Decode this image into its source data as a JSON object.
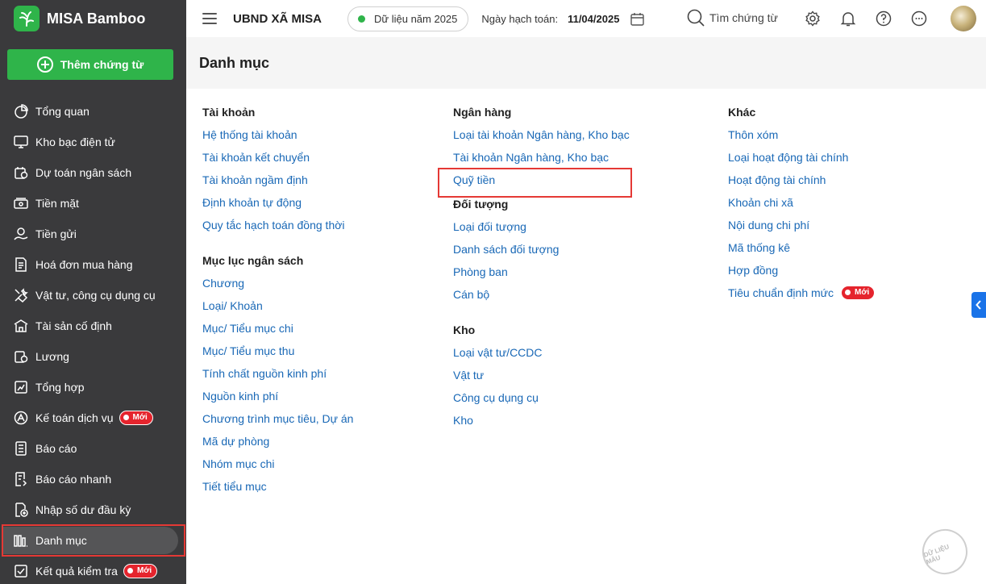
{
  "brand": {
    "name": "MISA Bamboo"
  },
  "sidebar": {
    "add_button": "Thêm chứng từ",
    "items": [
      {
        "label": "Tổng quan",
        "icon": "pie-chart-icon"
      },
      {
        "label": "Kho bạc điện tử",
        "icon": "monitor-icon"
      },
      {
        "label": "Dự toán ngân sách",
        "icon": "budget-icon"
      },
      {
        "label": "Tiền mặt",
        "icon": "cash-icon"
      },
      {
        "label": "Tiền gửi",
        "icon": "deposit-icon"
      },
      {
        "label": "Hoá đơn mua hàng",
        "icon": "invoice-icon"
      },
      {
        "label": "Vật tư, công cụ dụng cụ",
        "icon": "tools-icon"
      },
      {
        "label": "Tài sản cố định",
        "icon": "building-icon"
      },
      {
        "label": "Lương",
        "icon": "salary-icon"
      },
      {
        "label": "Tổng hợp",
        "icon": "summary-icon"
      },
      {
        "label": "Kế toán dịch vụ",
        "icon": "service-icon",
        "badge": "Mới"
      },
      {
        "label": "Báo cáo",
        "icon": "report-icon"
      },
      {
        "label": "Báo cáo nhanh",
        "icon": "quick-report-icon"
      },
      {
        "label": "Nhập số dư đầu kỳ",
        "icon": "opening-balance-icon"
      },
      {
        "label": "Danh mục",
        "icon": "catalog-icon",
        "active": true
      },
      {
        "label": "Kết quả kiểm tra",
        "icon": "check-result-icon",
        "badge": "Mới"
      }
    ]
  },
  "topbar": {
    "org_name": "UBND XÃ MISA",
    "data_year": "Dữ liệu năm 2025",
    "posting_date_label": "Ngày hạch toán:",
    "posting_date": "11/04/2025",
    "search_placeholder": "Tìm chứng từ"
  },
  "page": {
    "title": "Danh mục",
    "columns": [
      {
        "sections": [
          {
            "title": "Tài khoản",
            "links": [
              "Hệ thống tài khoản",
              "Tài khoản kết chuyển",
              "Tài khoản ngầm định",
              "Định khoản tự động",
              "Quy tắc hạch toán đồng thời"
            ]
          },
          {
            "title": "Mục lục ngân sách",
            "links": [
              "Chương",
              "Loại/ Khoản",
              "Mục/ Tiểu mục chi",
              "Mục/ Tiểu mục thu",
              "Tính chất nguồn kinh phí",
              "Nguồn kinh phí",
              "Chương trình mục tiêu, Dự án",
              "Mã dự phòng",
              "Nhóm mục chi",
              "Tiết tiểu mục"
            ]
          }
        ]
      },
      {
        "sections": [
          {
            "title": "Ngân hàng",
            "links": [
              "Loại tài khoản Ngân hàng, Kho bạc",
              "Tài khoản Ngân hàng, Kho bạc",
              "Quỹ tiền"
            ]
          },
          {
            "title": "Đối tượng",
            "links": [
              "Loại đối tượng",
              "Danh sách đối tượng",
              "Phòng ban",
              "Cán bộ"
            ]
          },
          {
            "title": "Kho",
            "links": [
              "Loại vật tư/CCDC",
              "Vật tư",
              "Công cụ dụng cụ",
              "Kho"
            ]
          }
        ]
      },
      {
        "sections": [
          {
            "title": "Khác",
            "links": [
              "Thôn xóm",
              "Loại hoạt động tài chính",
              "Hoạt động tài chính",
              "Khoản chi xã",
              "Nội dung chi phí",
              "Mã thống kê",
              "Hợp đồng",
              "Tiêu chuẩn định mức"
            ],
            "new_badge_on": "Tiêu chuẩn định mức",
            "badge": "Mới"
          }
        ]
      }
    ]
  },
  "watermark": "DỮ LIỆU MẪU",
  "colors": {
    "sidebar_bg": "#3a3a3c",
    "accent_green": "#2fb44a",
    "link_blue": "#1968b6",
    "highlight_red": "#e53935"
  }
}
